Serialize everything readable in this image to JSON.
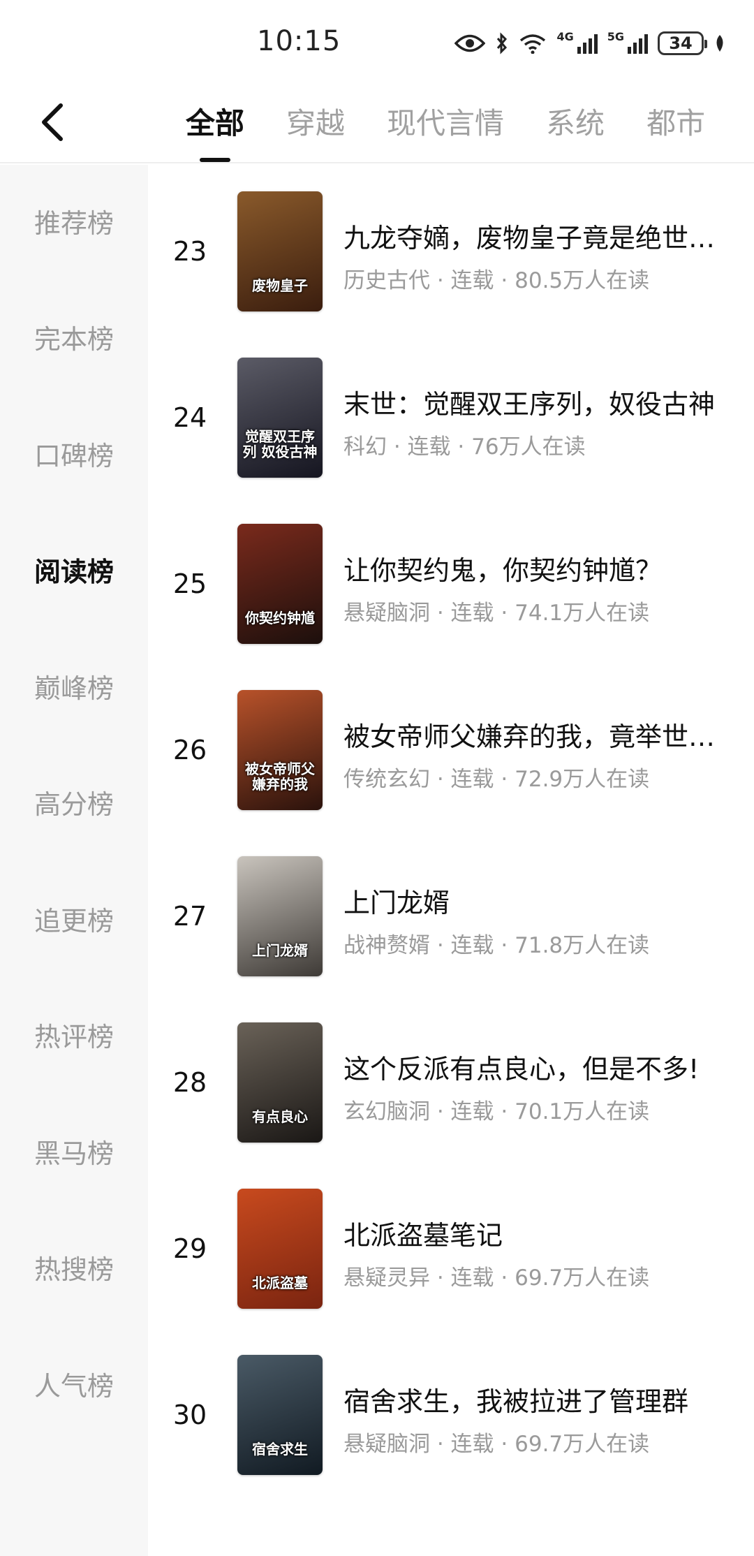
{
  "status_bar": {
    "time": "10:15",
    "signal_4g_label": "4G",
    "signal_5g_label": "5G",
    "battery": "34"
  },
  "nav": {
    "tabs": [
      {
        "label": "全部",
        "active": true
      },
      {
        "label": "穿越",
        "active": false
      },
      {
        "label": "现代言情",
        "active": false
      },
      {
        "label": "系统",
        "active": false
      },
      {
        "label": "都市",
        "active": false
      }
    ]
  },
  "sidebar": {
    "items": [
      {
        "label": "推荐榜"
      },
      {
        "label": "完本榜"
      },
      {
        "label": "口碑榜"
      },
      {
        "label": "阅读榜",
        "active": true
      },
      {
        "label": "巅峰榜"
      },
      {
        "label": "高分榜"
      },
      {
        "label": "追更榜"
      },
      {
        "label": "热评榜"
      },
      {
        "label": "黑马榜"
      },
      {
        "label": "热搜榜"
      },
      {
        "label": "人气榜"
      }
    ]
  },
  "books": [
    {
      "rank": "23",
      "title": "九龙夺嫡，废物皇子竟是绝世…",
      "meta": "历史古代 · 连载 · 80.5万人在读",
      "cover_text": "废物皇子",
      "cover_colors": [
        "#8a5a2b",
        "#3a1d0e"
      ]
    },
    {
      "rank": "24",
      "title": "末世：觉醒双王序列，奴役古神",
      "meta": "科幻 · 连载 · 76万人在读",
      "cover_text": "觉醒双王序列 奴役古神",
      "cover_colors": [
        "#5b5b66",
        "#151520"
      ]
    },
    {
      "rank": "25",
      "title": "让你契约鬼，你契约钟馗？",
      "meta": "悬疑脑洞 · 连载 · 74.1万人在读",
      "cover_text": "你契约钟馗",
      "cover_colors": [
        "#7a2a1c",
        "#1c0f0c"
      ]
    },
    {
      "rank": "26",
      "title": "被女帝师父嫌弃的我，竟举世…",
      "meta": "传统玄幻 · 连载 · 72.9万人在读",
      "cover_text": "被女帝师父 嫌弃的我",
      "cover_colors": [
        "#b8522a",
        "#2a120c"
      ]
    },
    {
      "rank": "27",
      "title": "上门龙婿",
      "meta": "战神赘婿 · 连载 · 71.8万人在读",
      "cover_text": "上门龙婿",
      "cover_colors": [
        "#c9c4bd",
        "#3e3a36"
      ]
    },
    {
      "rank": "28",
      "title": "这个反派有点良心，但是不多!",
      "meta": "玄幻脑洞 · 连载 · 70.1万人在读",
      "cover_text": "有点良心",
      "cover_colors": [
        "#6a6258",
        "#1a1715"
      ]
    },
    {
      "rank": "29",
      "title": "北派盗墓笔记",
      "meta": "悬疑灵异 · 连载 · 69.7万人在读",
      "cover_text": "北派盗墓",
      "cover_colors": [
        "#c84a1e",
        "#7a2410"
      ]
    },
    {
      "rank": "30",
      "title": "宿舍求生，我被拉进了管理群",
      "meta": "悬疑脑洞 · 连载 · 69.7万人在读",
      "cover_text": "宿舍求生",
      "cover_colors": [
        "#4a5a66",
        "#111a22"
      ]
    }
  ]
}
